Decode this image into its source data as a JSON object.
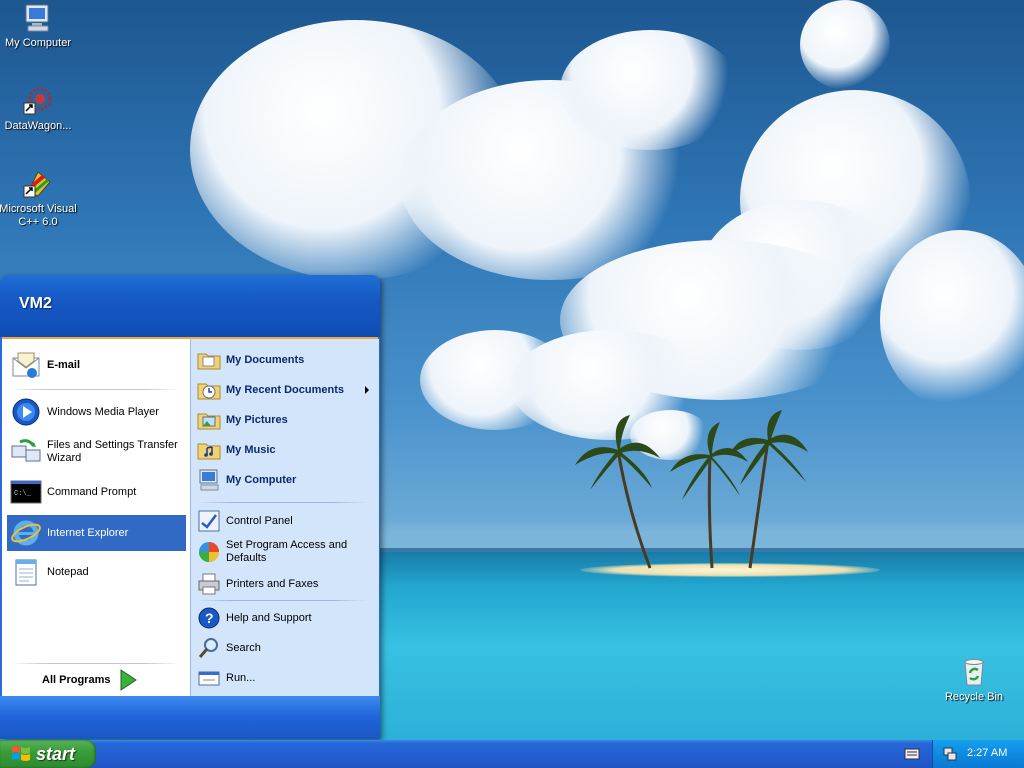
{
  "desktop": {
    "icons": [
      {
        "label": "My Computer"
      },
      {
        "label": "DataWagon..."
      },
      {
        "label": "Microsoft Visual C++ 6.0"
      },
      {
        "label": "Recycle Bin"
      }
    ]
  },
  "start_menu": {
    "user_name": "VM2",
    "left_pinned": [
      {
        "label": "E-mail",
        "icon": "email-icon"
      }
    ],
    "left_recent": [
      {
        "label": "Windows Media Player",
        "icon": "media-player-icon"
      },
      {
        "label": "Files and Settings Transfer Wizard",
        "icon": "transfer-wizard-icon"
      },
      {
        "label": "Command Prompt",
        "icon": "command-prompt-icon"
      },
      {
        "label": "Internet Explorer",
        "icon": "internet-explorer-icon"
      },
      {
        "label": "Notepad",
        "icon": "notepad-icon"
      }
    ],
    "all_programs_label": "All Programs",
    "right_places": [
      {
        "label": "My Documents",
        "icon": "folder-documents-icon"
      },
      {
        "label": "My Recent Documents",
        "icon": "recent-documents-icon"
      },
      {
        "label": "My Pictures",
        "icon": "folder-pictures-icon"
      },
      {
        "label": "My Music",
        "icon": "folder-music-icon"
      },
      {
        "label": "My Computer",
        "icon": "computer-icon"
      }
    ],
    "right_system": [
      {
        "label": "Control Panel",
        "icon": "control-panel-icon"
      },
      {
        "label": "Set Program Access and Defaults",
        "icon": "program-defaults-icon"
      },
      {
        "label": "Printers and Faxes",
        "icon": "printer-icon"
      }
    ],
    "right_help": [
      {
        "label": "Help and Support",
        "icon": "help-icon"
      },
      {
        "label": "Search",
        "icon": "search-icon"
      },
      {
        "label": "Run...",
        "icon": "run-icon"
      }
    ],
    "selected_item": "Internet Explorer"
  },
  "taskbar": {
    "start_label": "start",
    "clock": "2:27 AM"
  },
  "colors": {
    "taskbar_blue": "#245ed2",
    "start_green": "#3a9c3a",
    "menu_header": "#1659c4",
    "selection": "#316ac5",
    "right_pane": "#d3e5fa"
  }
}
